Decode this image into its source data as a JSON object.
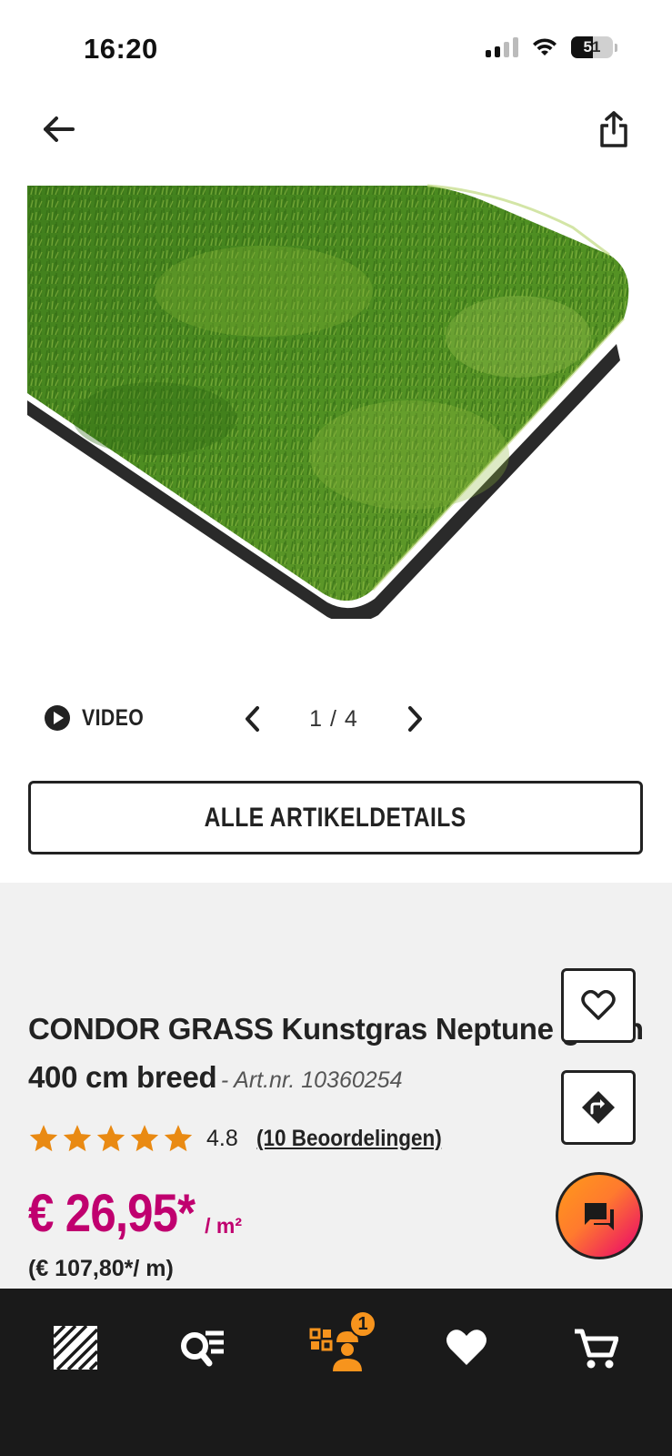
{
  "status_bar": {
    "time": "16:20",
    "battery": "51"
  },
  "nav": {
    "back_icon": "arrow-left-icon",
    "share_icon": "share-icon"
  },
  "gallery": {
    "video_label": "VIDEO",
    "counter": "1 / 4",
    "image_alt": "artificial-grass-product-image"
  },
  "details_button": {
    "label": "ALLE ARTIKELDETAILS"
  },
  "product": {
    "title": "CONDOR GRASS Kunstgras Neptune groen 400 cm breed",
    "art_nr": "- Art.nr. 10360254",
    "rating_value": "4.8",
    "rating_stars": 5,
    "reviews_label": "(10 Beoordelingen)",
    "price": "€ 26,95*",
    "price_unit": "/ m²",
    "price_secondary": "(€ 107,80*/ m)"
  },
  "colors": {
    "price": "#c0006f",
    "accent_orange": "#f7941d",
    "star": "#e98a13",
    "tabbar_bg": "#1a1a1a",
    "section_bg": "#f1f1f1"
  },
  "tab_bar": {
    "items": [
      {
        "name": "home-tab",
        "icon": "logo-stripes-icon"
      },
      {
        "name": "search-tab",
        "icon": "search-list-icon"
      },
      {
        "name": "store-tab",
        "icon": "store-worker-icon",
        "badge": "1"
      },
      {
        "name": "favorites-tab",
        "icon": "heart-icon"
      },
      {
        "name": "cart-tab",
        "icon": "cart-icon"
      }
    ]
  }
}
